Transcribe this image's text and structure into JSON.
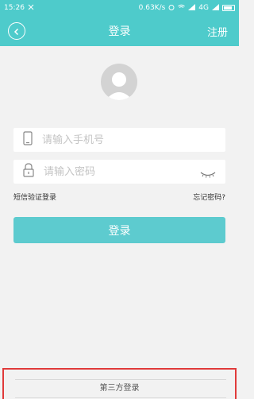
{
  "status_bar": {
    "time": "15:26",
    "speed": "0.63K/s",
    "network": "4G"
  },
  "header": {
    "title": "登录",
    "register_label": "注册"
  },
  "form": {
    "phone_placeholder": "请输入手机号",
    "password_placeholder": "请输入密码"
  },
  "links": {
    "sms_login": "短信验证登录",
    "forgot_password": "忘记密码?"
  },
  "login_button_label": "登录",
  "third_party": {
    "label": "第三方登录"
  },
  "colors": {
    "accent": "#4ecbcb",
    "button": "#5dcbcf",
    "highlight_border": "#e03a3a"
  }
}
